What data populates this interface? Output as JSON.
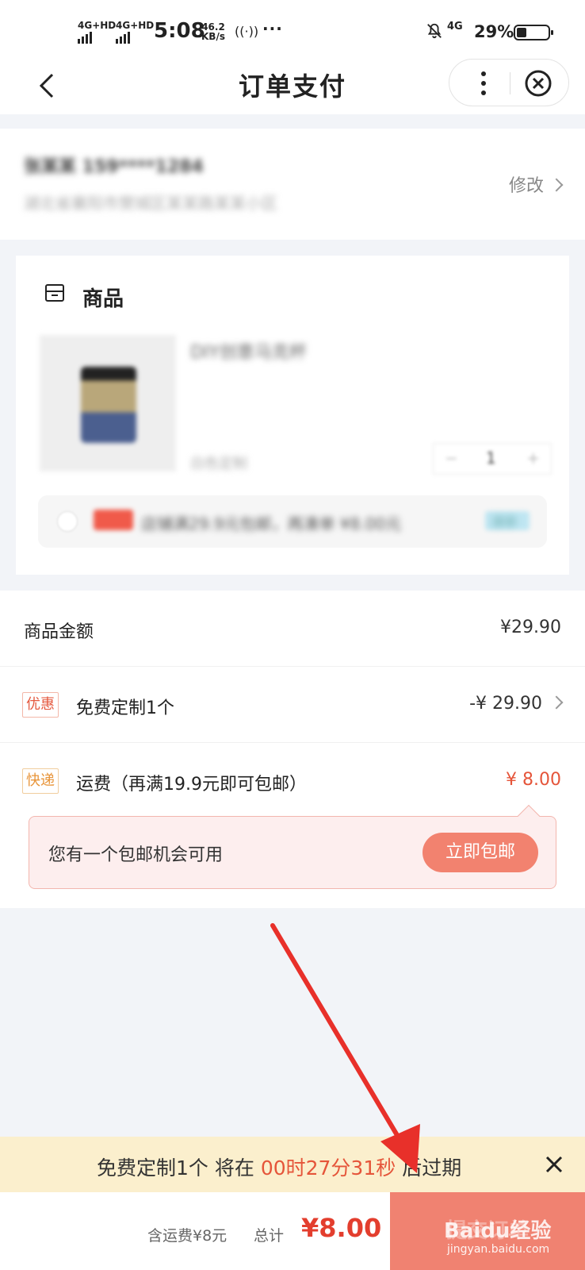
{
  "status_bar": {
    "sig1": "4G+HD",
    "sig2": "4G+HD",
    "time": "5:08",
    "speed_value": "46.2",
    "speed_unit": "KB/s",
    "nfc": "((·))",
    "dots": "···",
    "net": "4G",
    "battery": "29%"
  },
  "nav": {
    "title": "订单支付"
  },
  "address": {
    "name_line": "张某某 159****1284",
    "detail_line": "湖北省襄阳市樊城区某某路某某小区",
    "edit_label": "修改"
  },
  "product": {
    "section_label": "商品",
    "name": "DIY创意马克杯",
    "spec": "白色定制",
    "quantity": "1",
    "promo_text": "店铺满29.9元包邮，再凑单 ¥8.00元",
    "promo_btn": "凑单"
  },
  "summary": {
    "goods_amount_label": "商品金额",
    "goods_amount": "¥29.90",
    "discount_badge": "优惠",
    "discount_label": "免费定制1个",
    "discount_value": "-¥ 29.90",
    "shipping_badge": "快递",
    "shipping_label": "运费（再满19.9元即可包邮）",
    "shipping_value": "¥ 8.00"
  },
  "tooltip": {
    "message": "您有一个包邮机会可用",
    "button": "立即包邮"
  },
  "expire_banner": {
    "prefix": "免费定制1个 将在 ",
    "countdown": "00时27分31秒",
    "suffix": " 后过期"
  },
  "bottom_bar": {
    "shipping_note": "含运费¥8元",
    "total_label": "总计",
    "total_price": "¥8.00",
    "pay_button": "提交订单"
  },
  "watermark": {
    "brand": "Baidu经验",
    "url": "jingyan.baidu.com"
  },
  "colors": {
    "accent_red": "#e33e2e",
    "pay_button": "#f08271",
    "banner_bg": "#fbefcd",
    "tooltip_bg": "#fdeeee"
  }
}
